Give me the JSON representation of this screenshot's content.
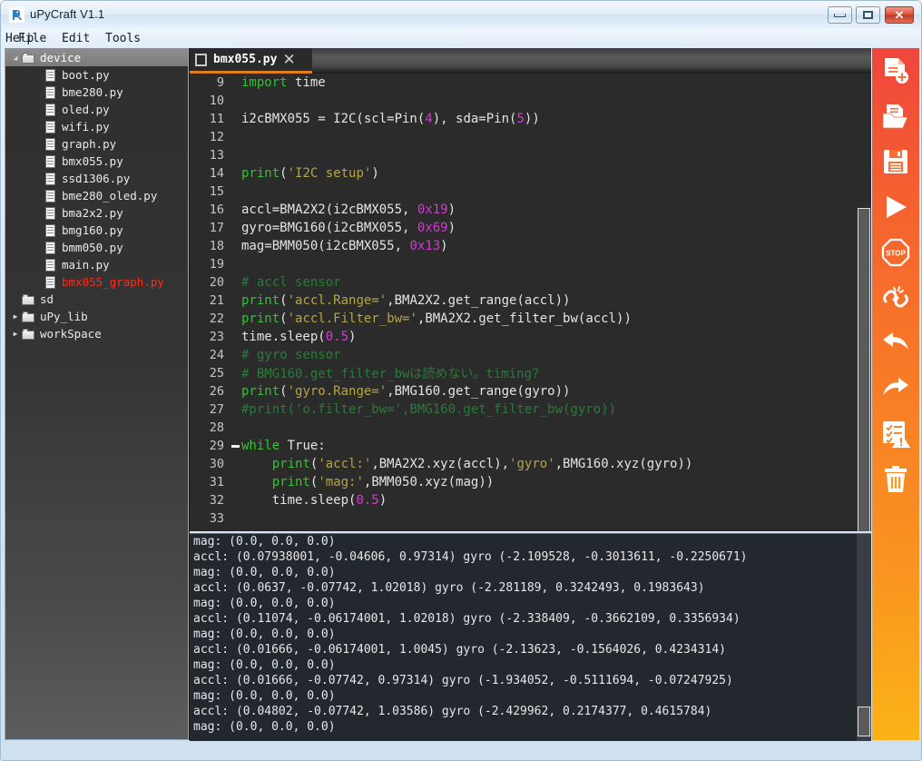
{
  "window": {
    "title": "uPyCraft V1.1",
    "icon": "app-icon",
    "buttons": {
      "minimize": "minimize",
      "maximize": "maximize",
      "close": "✕"
    }
  },
  "menubar": {
    "items": [
      {
        "label": "File"
      },
      {
        "label": "Edit"
      },
      {
        "label": "Tools"
      },
      {
        "label": "Help"
      }
    ]
  },
  "tree": {
    "rows": [
      {
        "label": "device",
        "type": "folder",
        "indent": 0,
        "arrow": "down",
        "selected": true,
        "highlighted": false
      },
      {
        "label": "boot.py",
        "type": "file",
        "indent": 1,
        "arrow": "",
        "selected": false,
        "highlighted": false
      },
      {
        "label": "bme280.py",
        "type": "file",
        "indent": 1,
        "arrow": "",
        "selected": false,
        "highlighted": false
      },
      {
        "label": "oled.py",
        "type": "file",
        "indent": 1,
        "arrow": "",
        "selected": false,
        "highlighted": false
      },
      {
        "label": "wifi.py",
        "type": "file",
        "indent": 1,
        "arrow": "",
        "selected": false,
        "highlighted": false
      },
      {
        "label": "graph.py",
        "type": "file",
        "indent": 1,
        "arrow": "",
        "selected": false,
        "highlighted": false
      },
      {
        "label": "bmx055.py",
        "type": "file",
        "indent": 1,
        "arrow": "",
        "selected": false,
        "highlighted": false
      },
      {
        "label": "ssd1306.py",
        "type": "file",
        "indent": 1,
        "arrow": "",
        "selected": false,
        "highlighted": false
      },
      {
        "label": "bme280_oled.py",
        "type": "file",
        "indent": 1,
        "arrow": "",
        "selected": false,
        "highlighted": false
      },
      {
        "label": "bma2x2.py",
        "type": "file",
        "indent": 1,
        "arrow": "",
        "selected": false,
        "highlighted": false
      },
      {
        "label": "bmg160.py",
        "type": "file",
        "indent": 1,
        "arrow": "",
        "selected": false,
        "highlighted": false
      },
      {
        "label": "bmm050.py",
        "type": "file",
        "indent": 1,
        "arrow": "",
        "selected": false,
        "highlighted": false
      },
      {
        "label": "main.py",
        "type": "file",
        "indent": 1,
        "arrow": "",
        "selected": false,
        "highlighted": false
      },
      {
        "label": "bmx055_graph.py",
        "type": "file",
        "indent": 1,
        "arrow": "",
        "selected": false,
        "highlighted": true
      },
      {
        "label": "sd",
        "type": "folder",
        "indent": 0,
        "arrow": "",
        "selected": false,
        "highlighted": false
      },
      {
        "label": "uPy_lib",
        "type": "folder",
        "indent": 0,
        "arrow": "right",
        "selected": false,
        "highlighted": false
      },
      {
        "label": "workSpace",
        "type": "folder",
        "indent": 0,
        "arrow": "right",
        "selected": false,
        "highlighted": false
      }
    ],
    "highlight_color": "#ff2a1a"
  },
  "editor": {
    "tab": {
      "title": "bmx055.py",
      "close_glyph": "✕",
      "underline_color": "#e07b20"
    },
    "first_line_number": 9,
    "lines": [
      {
        "no": 9,
        "fold": false,
        "tokens": [
          {
            "t": "import ",
            "c": "kw"
          },
          {
            "t": "time",
            "c": "def"
          }
        ]
      },
      {
        "no": 10,
        "fold": false,
        "tokens": []
      },
      {
        "no": 11,
        "fold": false,
        "tokens": [
          {
            "t": "i2cBMX055 = I2C(scl=Pin(",
            "c": "def"
          },
          {
            "t": "4",
            "c": "num"
          },
          {
            "t": "), sda=Pin(",
            "c": "def"
          },
          {
            "t": "5",
            "c": "num"
          },
          {
            "t": "))",
            "c": "def"
          }
        ]
      },
      {
        "no": 12,
        "fold": false,
        "tokens": []
      },
      {
        "no": 13,
        "fold": false,
        "tokens": []
      },
      {
        "no": 14,
        "fold": false,
        "tokens": [
          {
            "t": "print",
            "c": "fn"
          },
          {
            "t": "(",
            "c": "def"
          },
          {
            "t": "'I2C setup'",
            "c": "str"
          },
          {
            "t": ")",
            "c": "def"
          }
        ]
      },
      {
        "no": 15,
        "fold": false,
        "tokens": []
      },
      {
        "no": 16,
        "fold": false,
        "tokens": [
          {
            "t": "accl=BMA2X2(i2cBMX055, ",
            "c": "def"
          },
          {
            "t": "0x19",
            "c": "num"
          },
          {
            "t": ")",
            "c": "def"
          }
        ]
      },
      {
        "no": 17,
        "fold": false,
        "tokens": [
          {
            "t": "gyro=BMG160(i2cBMX055, ",
            "c": "def"
          },
          {
            "t": "0x69",
            "c": "num"
          },
          {
            "t": ")",
            "c": "def"
          }
        ]
      },
      {
        "no": 18,
        "fold": false,
        "tokens": [
          {
            "t": "mag=BMM050(i2cBMX055, ",
            "c": "def"
          },
          {
            "t": "0x13",
            "c": "num"
          },
          {
            "t": ")",
            "c": "def"
          }
        ]
      },
      {
        "no": 19,
        "fold": false,
        "tokens": []
      },
      {
        "no": 20,
        "fold": false,
        "tokens": [
          {
            "t": "# accl sensor",
            "c": "cmt"
          }
        ]
      },
      {
        "no": 21,
        "fold": false,
        "tokens": [
          {
            "t": "print",
            "c": "fn"
          },
          {
            "t": "(",
            "c": "def"
          },
          {
            "t": "'accl.Range='",
            "c": "str"
          },
          {
            "t": ",BMA2X2.get_range(accl))",
            "c": "def"
          }
        ]
      },
      {
        "no": 22,
        "fold": false,
        "tokens": [
          {
            "t": "print",
            "c": "fn"
          },
          {
            "t": "(",
            "c": "def"
          },
          {
            "t": "'accl.Filter_bw='",
            "c": "str"
          },
          {
            "t": ",BMA2X2.get_filter_bw(accl))",
            "c": "def"
          }
        ]
      },
      {
        "no": 23,
        "fold": false,
        "tokens": [
          {
            "t": "time.sleep(",
            "c": "def"
          },
          {
            "t": "0.5",
            "c": "num"
          },
          {
            "t": ")",
            "c": "def"
          }
        ]
      },
      {
        "no": 24,
        "fold": false,
        "tokens": [
          {
            "t": "# gyro sensor",
            "c": "cmt"
          }
        ]
      },
      {
        "no": 25,
        "fold": false,
        "tokens": [
          {
            "t": "# BMG160.get_filter_bwは読めない。timing?",
            "c": "cmt"
          }
        ]
      },
      {
        "no": 26,
        "fold": false,
        "tokens": [
          {
            "t": "print",
            "c": "fn"
          },
          {
            "t": "(",
            "c": "def"
          },
          {
            "t": "'gyro.Range='",
            "c": "str"
          },
          {
            "t": ",BMG160.get_range(gyro))",
            "c": "def"
          }
        ]
      },
      {
        "no": 27,
        "fold": false,
        "tokens": [
          {
            "t": "#print('o.filter_bw=',BMG160.get_filter_bw(gyro))",
            "c": "cmt"
          }
        ]
      },
      {
        "no": 28,
        "fold": false,
        "tokens": []
      },
      {
        "no": 29,
        "fold": true,
        "tokens": [
          {
            "t": "while",
            "c": "kw"
          },
          {
            "t": " True:",
            "c": "def"
          }
        ]
      },
      {
        "no": 30,
        "fold": false,
        "tokens": [
          {
            "t": "    ",
            "c": "def"
          },
          {
            "t": "print",
            "c": "fn"
          },
          {
            "t": "(",
            "c": "def"
          },
          {
            "t": "'accl:'",
            "c": "str"
          },
          {
            "t": ",BMA2X2.xyz(accl),",
            "c": "def"
          },
          {
            "t": "'gyro'",
            "c": "str"
          },
          {
            "t": ",BMG160.xyz(gyro))",
            "c": "def"
          }
        ]
      },
      {
        "no": 31,
        "fold": false,
        "tokens": [
          {
            "t": "    ",
            "c": "def"
          },
          {
            "t": "print",
            "c": "fn"
          },
          {
            "t": "(",
            "c": "def"
          },
          {
            "t": "'mag:'",
            "c": "str"
          },
          {
            "t": ",BMM050.xyz(mag))",
            "c": "def"
          }
        ]
      },
      {
        "no": 32,
        "fold": false,
        "tokens": [
          {
            "t": "    time.sleep(",
            "c": "def"
          },
          {
            "t": "0.5",
            "c": "num"
          },
          {
            "t": ")",
            "c": "def"
          }
        ]
      },
      {
        "no": 33,
        "fold": false,
        "tokens": []
      }
    ]
  },
  "console": {
    "lines": [
      "mag: (0.0, 0.0, 0.0)",
      "accl: (0.07938001, -0.04606, 0.97314) gyro (-2.109528, -0.3013611, -0.2250671)",
      "mag: (0.0, 0.0, 0.0)",
      "accl: (0.0637, -0.07742, 1.02018) gyro (-2.281189, 0.3242493, 0.1983643)",
      "mag: (0.0, 0.0, 0.0)",
      "accl: (0.11074, -0.06174001, 1.02018) gyro (-2.338409, -0.3662109, 0.3356934)",
      "mag: (0.0, 0.0, 0.0)",
      "accl: (0.01666, -0.06174001, 1.0045) gyro (-2.13623, -0.1564026, 0.4234314)",
      "mag: (0.0, 0.0, 0.0)",
      "accl: (0.01666, -0.07742, 0.97314) gyro (-1.934052, -0.5111694, -0.07247925)",
      "mag: (0.0, 0.0, 0.0)",
      "accl: (0.04802, -0.07742, 1.03586) gyro (-2.429962, 0.2174377, 0.4615784)",
      "mag: (0.0, 0.0, 0.0)"
    ]
  },
  "toolbar": {
    "gradient_top": "#f0453c",
    "gradient_bottom": "#fbb317",
    "buttons": [
      {
        "icon": "new-file-icon",
        "title": "New file"
      },
      {
        "icon": "open-folder-icon",
        "title": "Open"
      },
      {
        "icon": "save-icon",
        "title": "Save"
      },
      {
        "icon": "run-icon",
        "title": "Run"
      },
      {
        "icon": "stop-icon",
        "title": "Stop"
      },
      {
        "icon": "disconnect-icon",
        "title": "Disconnect"
      },
      {
        "icon": "undo-icon",
        "title": "Undo"
      },
      {
        "icon": "redo-icon",
        "title": "Redo"
      },
      {
        "icon": "syntax-check-icon",
        "title": "Syntax check"
      },
      {
        "icon": "delete-icon",
        "title": "Delete"
      }
    ]
  }
}
